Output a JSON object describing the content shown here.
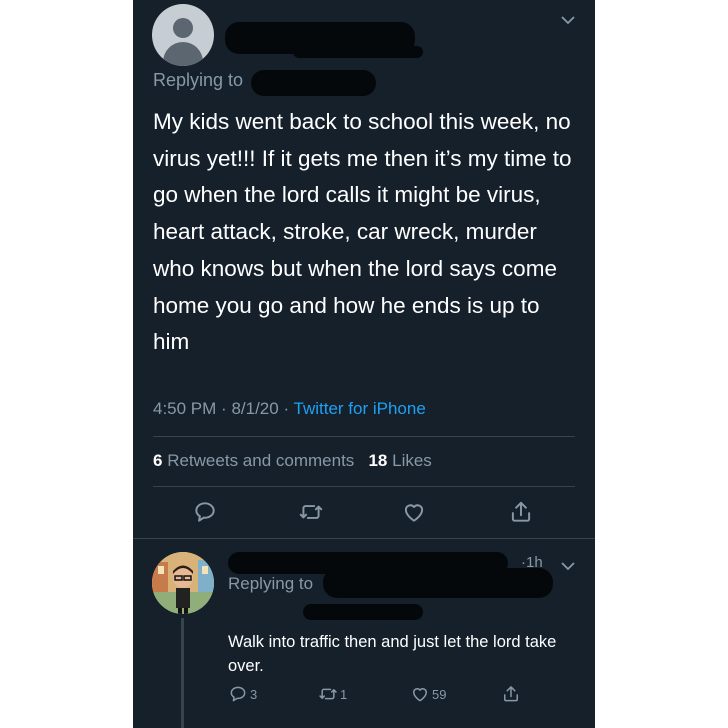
{
  "tweet": {
    "replying_prefix": "Replying to",
    "body": "My kids went back to school this week, no virus yet!!! If it gets me then it’s my time to go when the lord calls it might be virus, heart attack, stroke, car wreck, murder who knows but when the lord says come home you go and how he ends is up to him",
    "time": "4:50 PM",
    "date": "8/1/20",
    "client": "Twitter for iPhone",
    "retweets_count": "6",
    "retweets_label": "Retweets and comments",
    "likes_count": "18",
    "likes_label": "Likes"
  },
  "reply": {
    "replying_prefix": "Replying to",
    "age": "1h",
    "body": "Walk into traffic then and just let the lord take over.",
    "reply_count": "3",
    "retweet_count": "1",
    "like_count": "59"
  },
  "colors": {
    "background": "#15202b",
    "secondary_text": "#8899a6",
    "link": "#1da1f2",
    "divider": "#38444d"
  }
}
